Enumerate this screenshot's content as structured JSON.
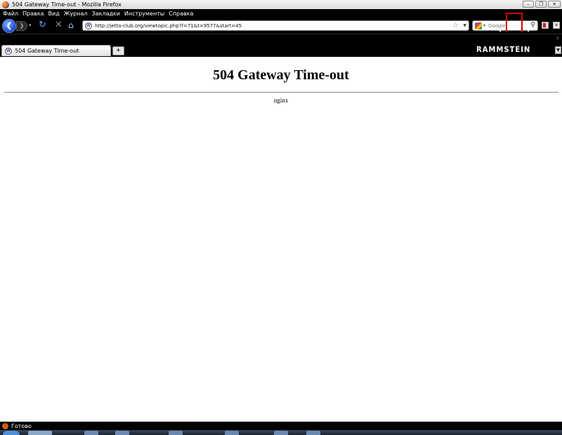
{
  "window": {
    "title": "504 Gateway Time-out - Mozilla Firefox"
  },
  "menu": [
    "Файл",
    "Правка",
    "Вид",
    "Журнал",
    "Закладки",
    "Инструменты",
    "Справка"
  ],
  "navigation": {
    "url": "http://jetta-club.org/viewtopic.php?f=71&t=9577&start=45",
    "search_placeholder": "Google"
  },
  "tabs": [
    {
      "label": "504 Gateway Time-out",
      "active": true
    }
  ],
  "tabbar": {
    "new_tab_label": "+",
    "persona_logo": "RAMMSTEIN"
  },
  "page": {
    "heading": "504 Gateway Time-out",
    "server": "nginx"
  },
  "status": {
    "text": "Готово"
  },
  "colors": {
    "chrome_background": "#000000",
    "content_background": "#ffffff",
    "accent_red": "#cc0000",
    "back_button_blue": "#1c4fd8"
  }
}
